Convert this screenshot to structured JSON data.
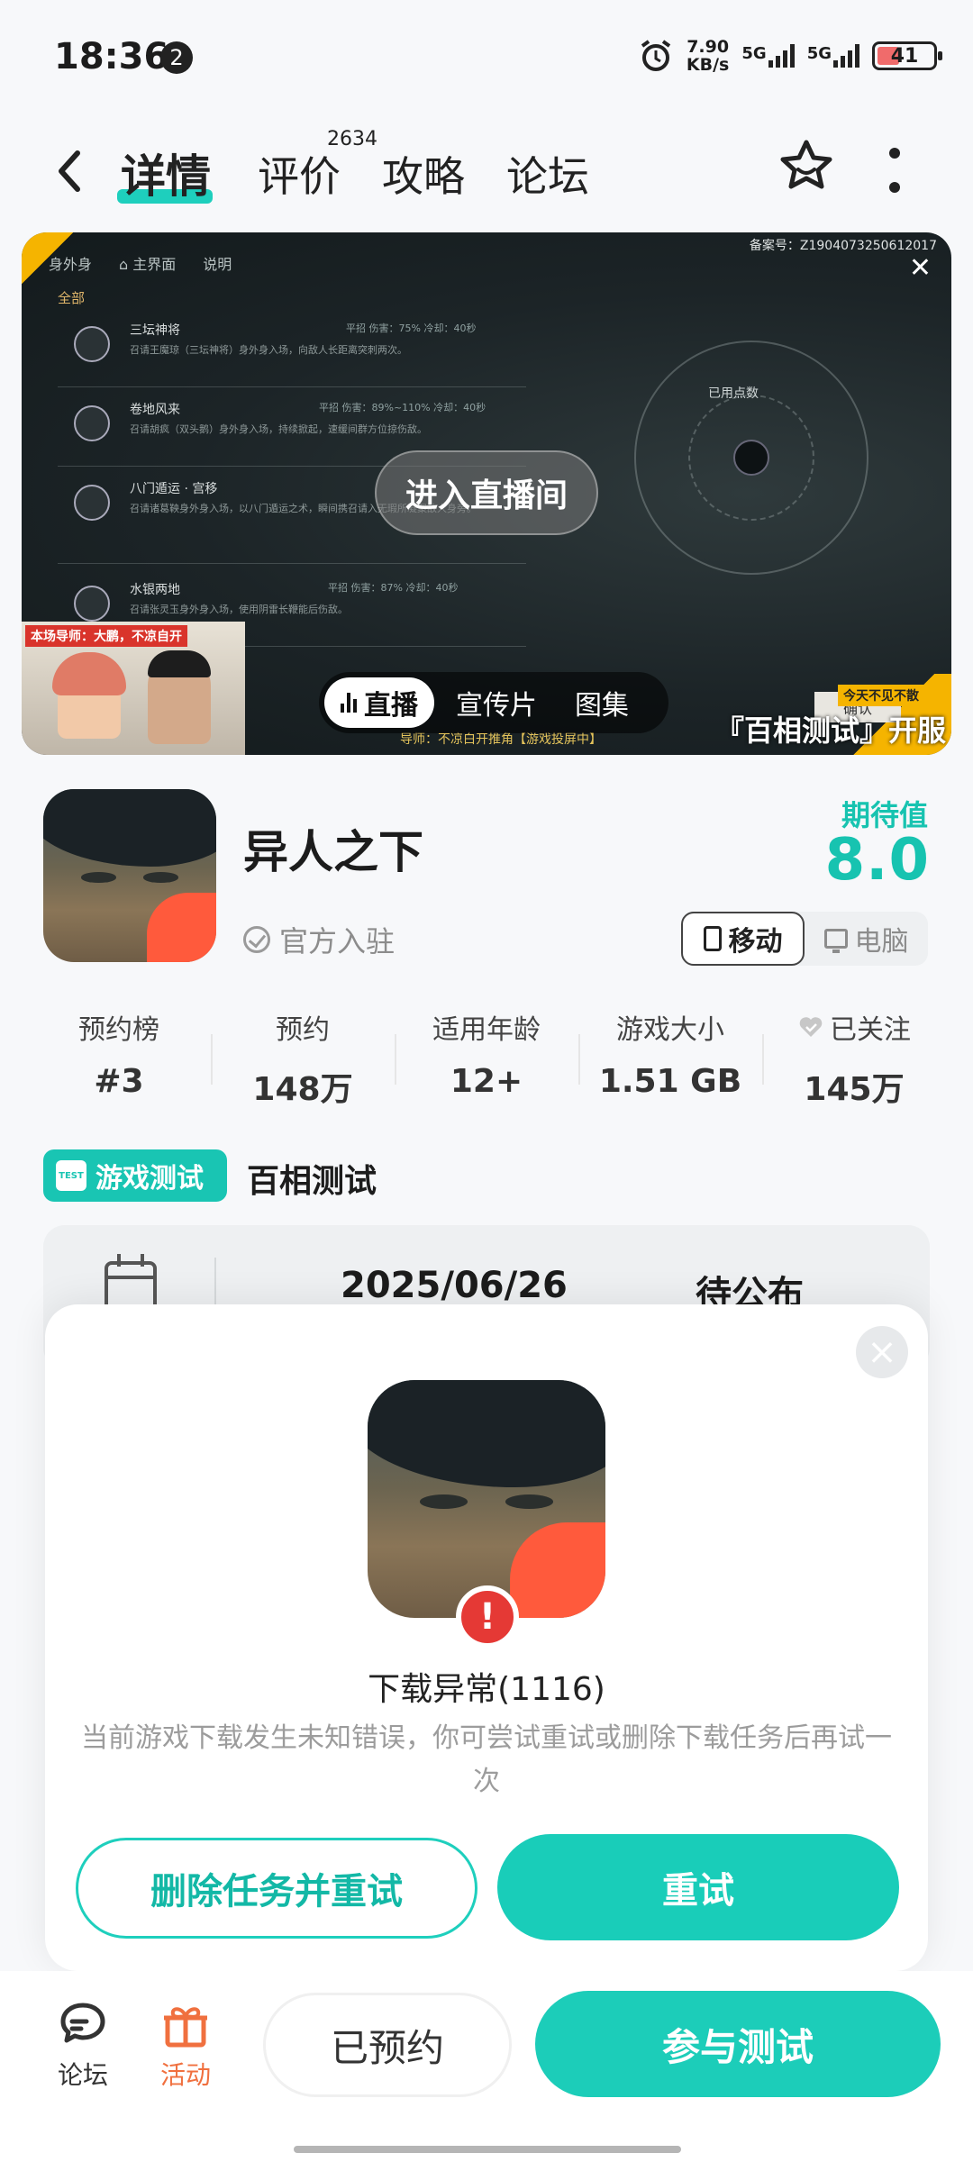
{
  "status_bar": {
    "time": "18:36",
    "notification_count": "2",
    "speed_value": "7.90",
    "speed_unit": "KB/s",
    "network1": "5G",
    "network2": "5G",
    "battery": "41"
  },
  "nav": {
    "tabs": [
      {
        "label": "详情"
      },
      {
        "label": "评价"
      },
      {
        "label": "攻略"
      },
      {
        "label": "论坛"
      }
    ],
    "review_count": "2634"
  },
  "media": {
    "record_no": "备案号：Z1904073250612017",
    "menu_title": "身外身",
    "menu_home": "主界面",
    "menu_help": "说明",
    "menu_all": "全部",
    "skills": [
      {
        "name": "三坛神将",
        "stat": "平招  伤害：75%  冷却：40秒",
        "desc": "召请王魔琼（三坛神将）身外身入场，向敌人长距离突刺两次。"
      },
      {
        "name": "卷地风来",
        "stat": "平招  伤害：89%~110%  冷却：40秒",
        "desc": "召请胡疯（双头鹅）身外身入场，持续掀起，速缓间群方位掠伤敌。"
      },
      {
        "name": "八门遁运 · 宫移",
        "stat": "",
        "desc": "召请诸葛鞅身外身入场，以八门遁运之术，瞬间携召请入无瑕所凝聚敌人身旁。"
      },
      {
        "name": "水银两地",
        "stat": "平招  伤害：87%  冷却：40秒",
        "desc": "召请张灵玉身外身入场，使用阴雷长鞭能后伤敌。"
      }
    ],
    "used_points": "已用点数",
    "live_button": "进入直播间",
    "streamer_label": "本场导师：大鹏，不凉自开",
    "tabs": [
      {
        "label": "直播"
      },
      {
        "label": "宣传片"
      },
      {
        "label": "图集"
      }
    ],
    "banner_sub": "今天不见不散",
    "banner": "『百相测试』开服",
    "confirm": "确认",
    "caption": "导师：不凉白开推角【游戏投屏中】"
  },
  "game": {
    "title": "异人之下",
    "official": "官方入驻",
    "expect_label": "期待值",
    "expect_value": "8.0",
    "platforms": [
      {
        "label": "移动"
      },
      {
        "label": "电脑"
      }
    ]
  },
  "stats": [
    {
      "label": "预约榜",
      "value": "#3"
    },
    {
      "label": "预约",
      "value": "148万"
    },
    {
      "label": "适用年龄",
      "value": "12+"
    },
    {
      "label": "游戏大小",
      "value": "1.51 GB"
    },
    {
      "label": "已关注",
      "value": "145万"
    }
  ],
  "test": {
    "tag": "游戏测试",
    "tag_icon": "TEST",
    "name": "百相测试",
    "date": "2025/06/26",
    "status": "待公布"
  },
  "modal": {
    "title": "下载异常(1116)",
    "description": "当前游戏下载发生未知错误，你可尝试重试或删除下载任务后再试一次",
    "delete_retry": "删除任务并重试",
    "retry": "重试"
  },
  "bottom": {
    "forum": "论坛",
    "activity": "活动",
    "reserved": "已预约",
    "join": "参与测试"
  },
  "colors": {
    "accent": "#19cdb9",
    "error": "#e53935",
    "activity": "#f0703f"
  }
}
